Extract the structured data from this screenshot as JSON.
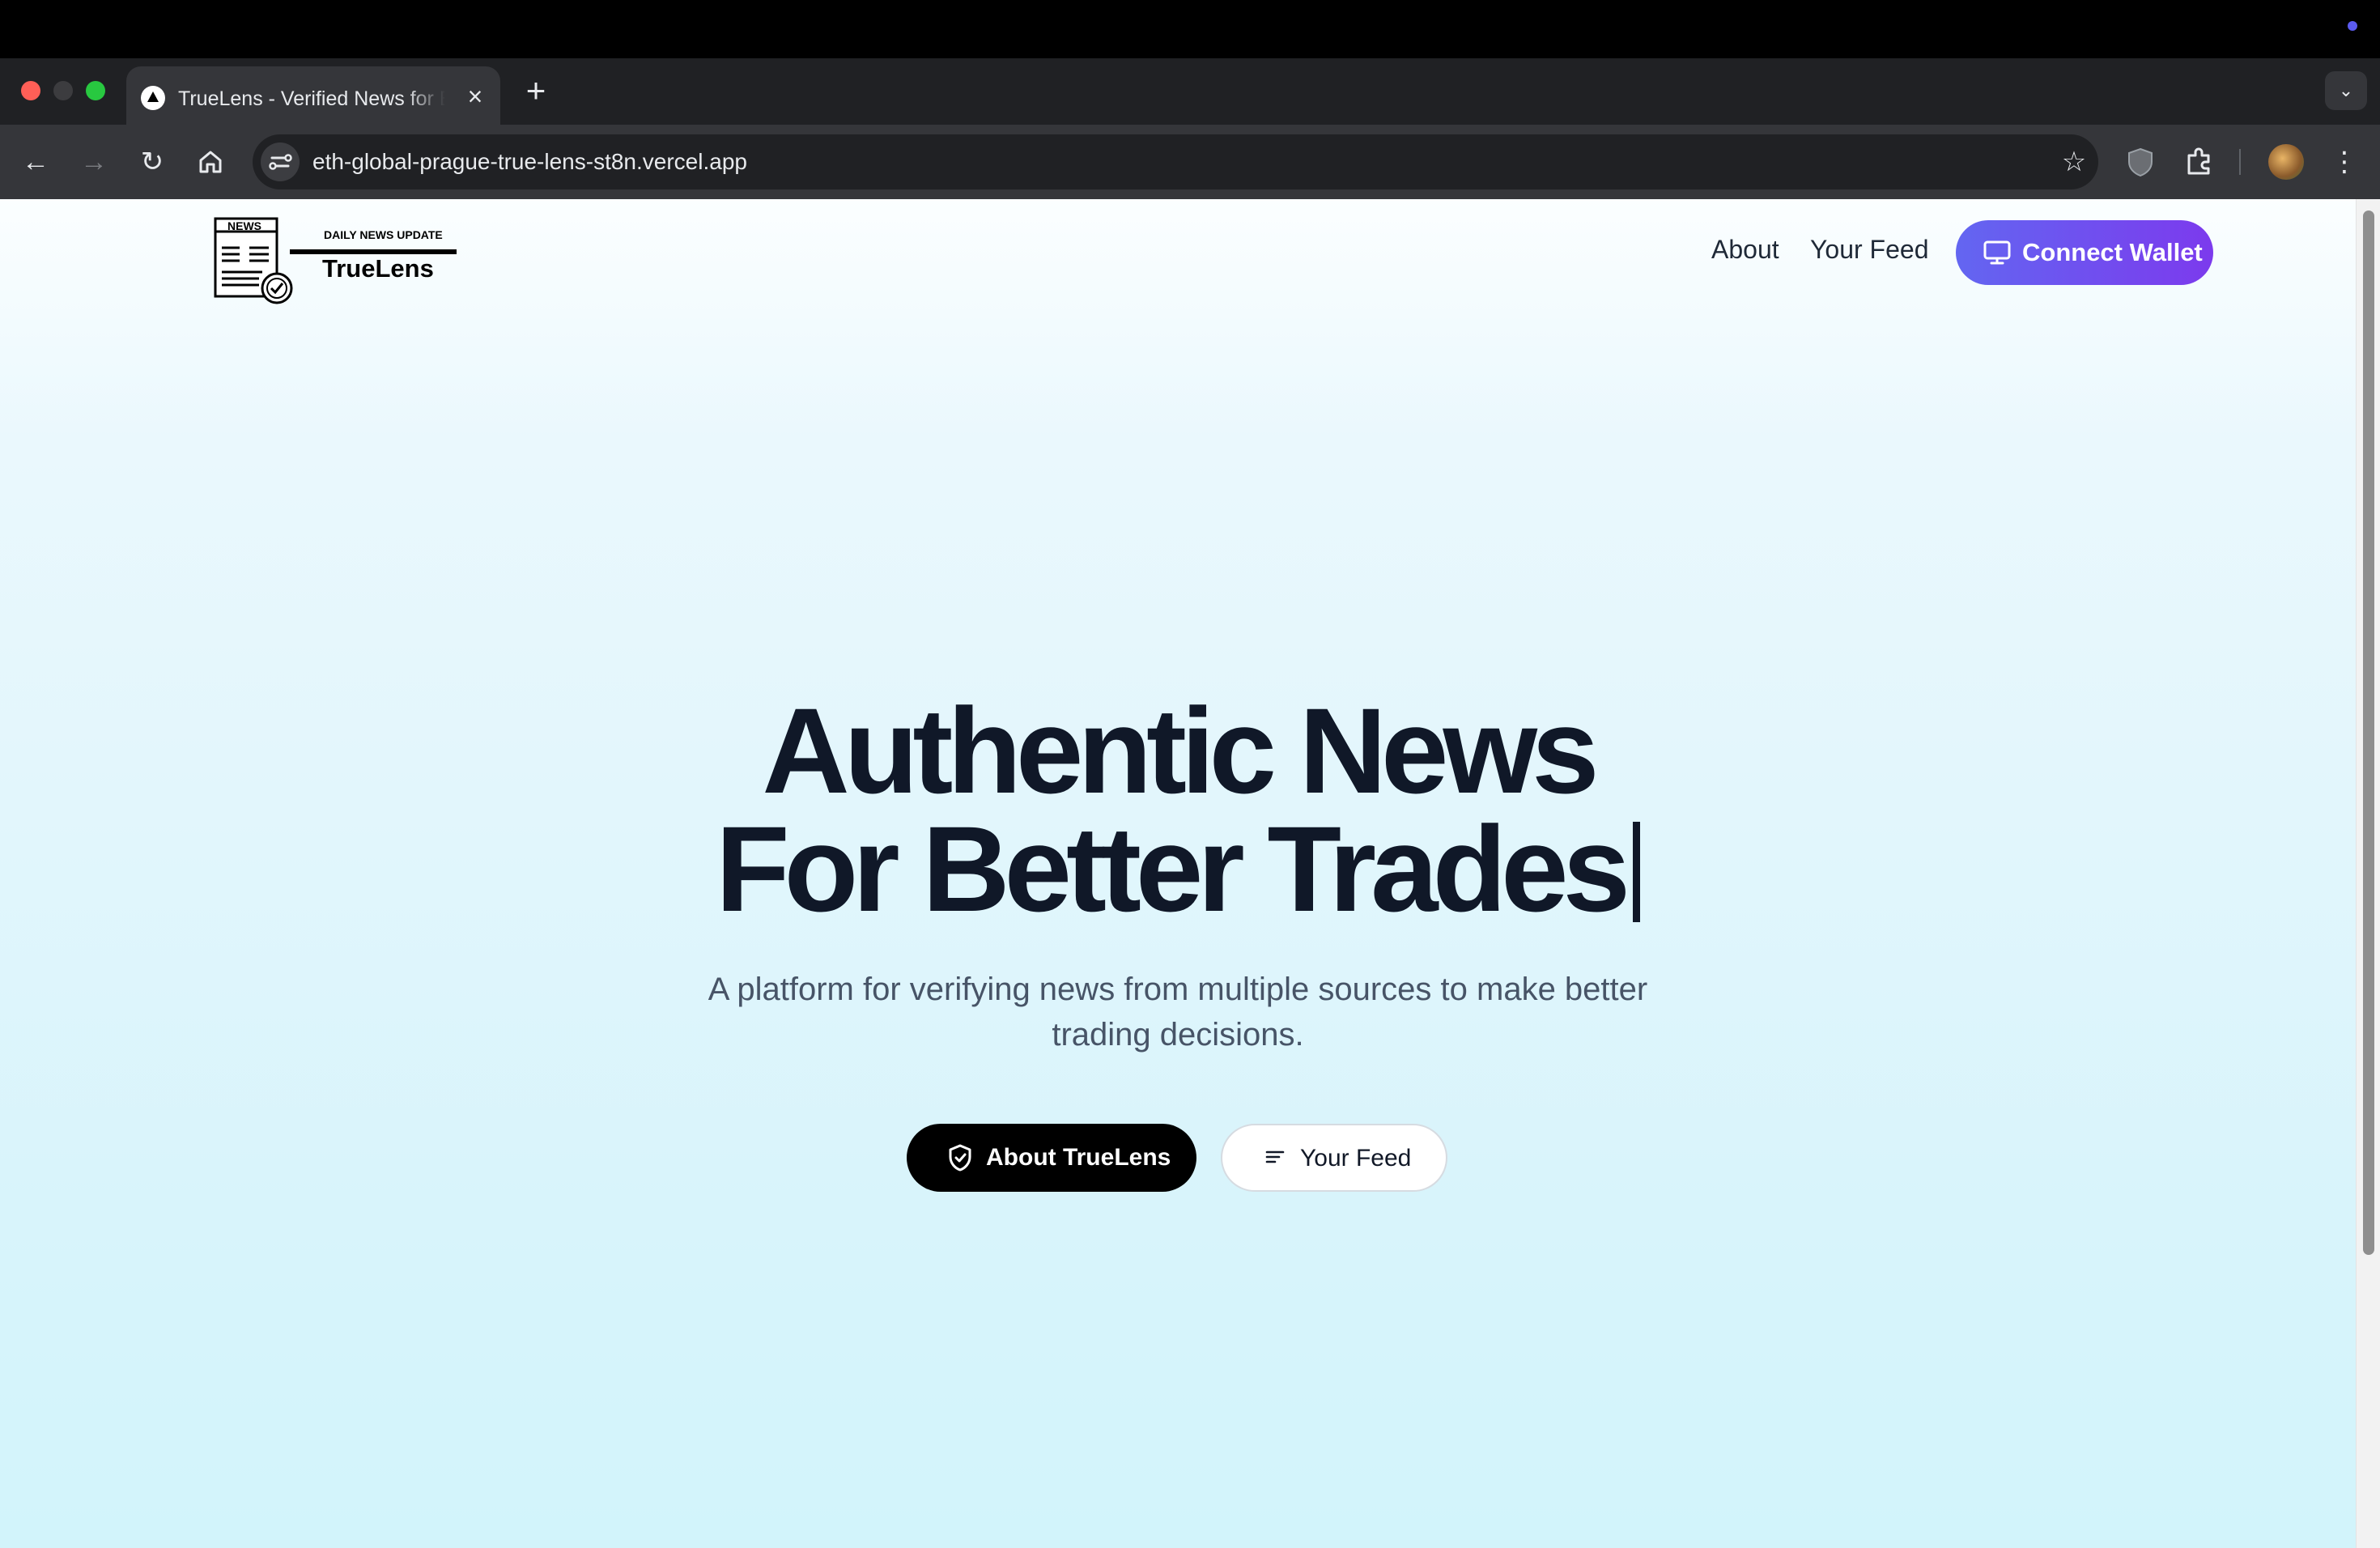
{
  "browser": {
    "tab_title": "TrueLens - Verified News for Better Trades",
    "tab_close": "×",
    "new_tab": "+",
    "url": "eth-global-prague-true-lens-st8n.vercel.app",
    "icons": [
      "back-icon",
      "forward-icon",
      "reload-icon",
      "home-icon",
      "site-info-icon",
      "bookmark-star-icon",
      "shield-extension-icon",
      "extensions-icon",
      "profile-avatar",
      "more-menu-icon",
      "tab-search-icon"
    ]
  },
  "site": {
    "logo": {
      "badge_text": "NEWS",
      "tagline": "DAILY NEWS UPDATE",
      "name": "TrueLens"
    },
    "nav": {
      "about": "About",
      "feed": "Your Feed",
      "connect_wallet": "Connect Wallet"
    },
    "hero": {
      "title_line1": "Authentic News",
      "title_line2": "For Better Trades",
      "subtitle": "A platform for verifying news from multiple sources to make better trading decisions.",
      "primary_button": "About TrueLens",
      "secondary_button": "Your Feed"
    }
  },
  "colors": {
    "accent_gradient_start": "#6366f1",
    "accent_gradient_end": "#7c3aed",
    "title_text": "#101828",
    "background": "#e2f6fc"
  }
}
